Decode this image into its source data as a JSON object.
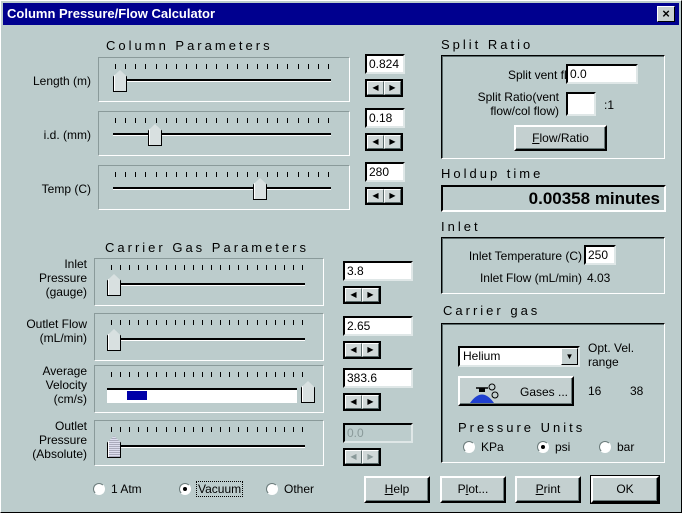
{
  "window": {
    "title": "Column Pressure/Flow Calculator",
    "close_label": "×"
  },
  "column_parameters": {
    "title": "Column Parameters",
    "sliders": [
      {
        "label": "Length (m)",
        "value": "0.824",
        "position_fraction": 0.0
      },
      {
        "label": "i.d. (mm)",
        "value": "0.18",
        "position_fraction": 0.17
      },
      {
        "label": "Temp (C)",
        "value": "280",
        "position_fraction": 0.68
      }
    ]
  },
  "carrier_gas_parameters": {
    "title": "Carrier Gas Parameters",
    "sliders": [
      {
        "label_lines": [
          "Inlet",
          "Pressure",
          "(gauge)"
        ],
        "value": "3.8",
        "position_fraction": 0.0,
        "disabled": false
      },
      {
        "label_lines": [
          "Outlet Flow",
          "(mL/min)"
        ],
        "value": "2.65",
        "position_fraction": 0.0,
        "disabled": false
      },
      {
        "label_lines": [
          "Average",
          "Velocity",
          "(cm/s)"
        ],
        "value": "383.6",
        "position_fraction": 1.0,
        "disabled": false,
        "optimal_range_highlight": true
      },
      {
        "label_lines": [
          "Outlet",
          "Pressure",
          "(Absolute)"
        ],
        "value": "0.0",
        "position_fraction": 0.0,
        "disabled": true
      }
    ],
    "outlet_options": [
      {
        "label": "1 Atm",
        "selected": false
      },
      {
        "label": "Vacuum",
        "selected": true
      },
      {
        "label": "Other",
        "selected": false
      }
    ]
  },
  "split_ratio": {
    "title": "Split Ratio",
    "vent_flow_label": "Split vent flow",
    "vent_flow_value": "0.0",
    "ratio_label_lines": [
      "Split Ratio(vent",
      "flow/col flow)"
    ],
    "ratio_value": "",
    "ratio_suffix": ":1",
    "button_label": "Flow/Ratio",
    "button_mnemonic": "F"
  },
  "holdup": {
    "title": "Holdup time",
    "value": "0.00358 minutes"
  },
  "inlet": {
    "title": "Inlet",
    "temperature_label": "Inlet Temperature (C)",
    "temperature_value": "250",
    "flow_label": "Inlet Flow (mL/min)",
    "flow_value": "4.03"
  },
  "carrier_gas": {
    "title": "Carrier gas",
    "selected_gas": "Helium",
    "opt_vel_label_lines": [
      "Opt. Vel.",
      "range"
    ],
    "opt_vel_min": "16",
    "opt_vel_max": "38",
    "gases_button": "Gases ...",
    "pressure_units_title": "Pressure Units",
    "pressure_units": [
      {
        "label": "KPa",
        "selected": false
      },
      {
        "label": "psi",
        "selected": true
      },
      {
        "label": "bar",
        "selected": false
      }
    ]
  },
  "buttons": {
    "help": {
      "label": "Help",
      "mnemonic": "H"
    },
    "plot": {
      "label": "Plot...",
      "mnemonic": "l"
    },
    "print": {
      "label": "Print",
      "mnemonic": "P"
    },
    "ok": {
      "label": "OK"
    }
  },
  "colors": {
    "titlebar": "#00008f",
    "dialog_bg": "#bccccc",
    "velocity_range_bar": "#0000a8"
  }
}
